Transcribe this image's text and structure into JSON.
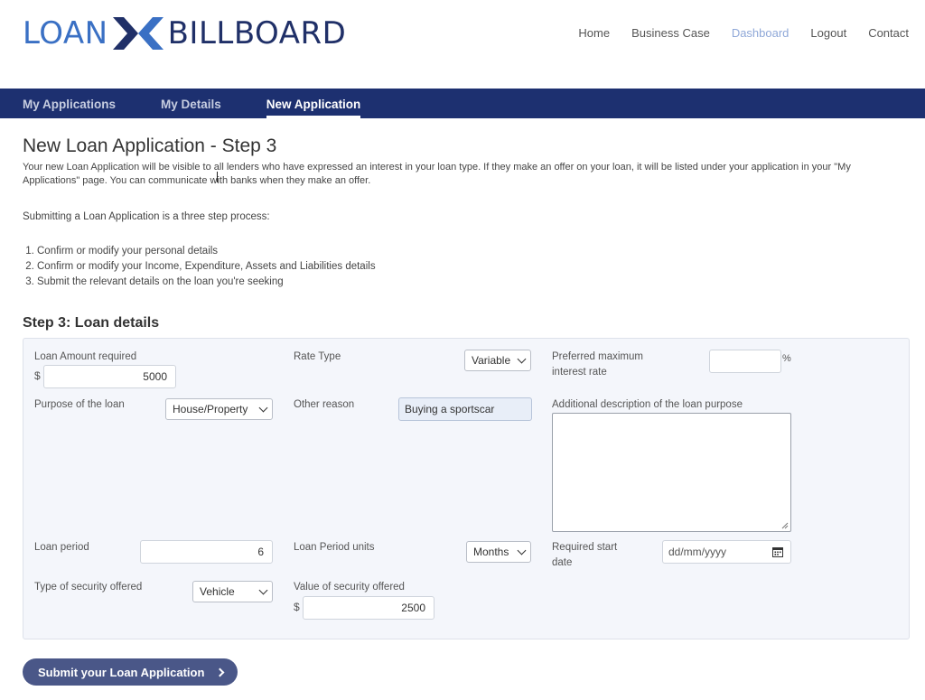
{
  "brand": {
    "left": "LOAN",
    "right": "BILLBOARD"
  },
  "topnav": [
    {
      "label": "Home",
      "active": false
    },
    {
      "label": "Business Case",
      "active": false
    },
    {
      "label": "Dashboard",
      "active": true
    },
    {
      "label": "Logout",
      "active": false
    },
    {
      "label": "Contact",
      "active": false
    }
  ],
  "tabs": [
    {
      "label": "My Applications",
      "active": false
    },
    {
      "label": "My Details",
      "active": false
    },
    {
      "label": "New Application",
      "active": true
    }
  ],
  "page": {
    "title": "New Loan Application - Step 3",
    "intro": "Your new Loan Application will be visible to all lenders who have expressed an interest in your loan type. If they make an offer on your loan, it will be listed under your application in your \"My Applications\" page. You can communicate with banks when they make an offer.",
    "process_text": "Submitting a Loan Application is a three step process:",
    "steps": [
      "Confirm or modify your personal details",
      "Confirm or modify your Income, Expenditure, Assets and Liabilities details",
      "Submit the relevant details on the loan you're seeking"
    ],
    "section_title": "Step 3: Loan details"
  },
  "form": {
    "loan_amount": {
      "label": "Loan Amount required",
      "currency": "$",
      "value": "5000"
    },
    "rate_type": {
      "label": "Rate Type",
      "selected": "Variable"
    },
    "max_rate": {
      "label_line1": "Preferred maximum",
      "label_line2": "interest rate",
      "value": "",
      "suffix": "%"
    },
    "purpose": {
      "label": "Purpose of the loan",
      "selected": "House/Property"
    },
    "other_reason": {
      "label": "Other reason",
      "value": "Buying a sportscar"
    },
    "description": {
      "label": "Additional description of the loan purpose",
      "value": ""
    },
    "loan_period": {
      "label": "Loan period",
      "value": "6"
    },
    "period_units": {
      "label": "Loan Period units",
      "selected": "Months"
    },
    "start_date": {
      "label_line1": "Required start",
      "label_line2": "date",
      "placeholder": "dd/mm/yyyy"
    },
    "security_type": {
      "label": "Type of security offered",
      "selected": "Vehicle"
    },
    "security_value": {
      "label": "Value of security offered",
      "currency": "$",
      "value": "2500"
    }
  },
  "submit_label": "Submit your Loan Application",
  "colors": {
    "navbar": "#1d3070",
    "brand_light": "#3a70c4",
    "brand_dark": "#203068",
    "button": "#4a5788",
    "active_link": "#8fa8d8"
  }
}
